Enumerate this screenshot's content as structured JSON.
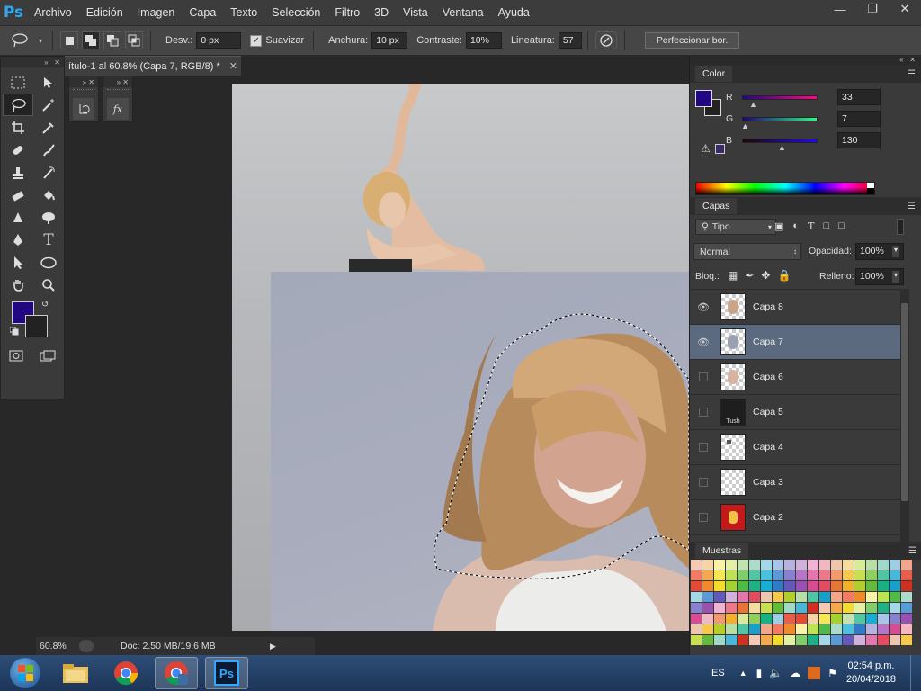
{
  "app": {
    "logo": "Ps"
  },
  "menu": [
    "Archivo",
    "Edición",
    "Imagen",
    "Capa",
    "Texto",
    "Selección",
    "Filtro",
    "3D",
    "Vista",
    "Ventana",
    "Ayuda"
  ],
  "options": {
    "feather_label": "Desv.:",
    "feather_value": "0 px",
    "antialias_label": "Suavizar",
    "antialias_checked": true,
    "width_label": "Anchura:",
    "width_value": "10 px",
    "contrast_label": "Contraste:",
    "contrast_value": "10%",
    "frequency_label": "Lineatura:",
    "frequency_value": "57",
    "refine_button": "Perfeccionar bor."
  },
  "document": {
    "tab_title": "ítulo-1 al 60.8% (Capa 7, RGB/8) *",
    "zoom": "60.8%",
    "doc_info": "Doc: 2.50 MB/19.6 MB"
  },
  "color_panel": {
    "title": "Color",
    "foreground": "#210782",
    "background": "#222222",
    "channels": [
      {
        "label": "R",
        "value": "33"
      },
      {
        "label": "G",
        "value": "7"
      },
      {
        "label": "B",
        "value": "130"
      }
    ]
  },
  "layers_panel": {
    "title": "Capas",
    "filter_label": "Tipo",
    "blend_mode": "Normal",
    "opacity_label": "Opacidad:",
    "opacity_value": "100%",
    "lock_label": "Bloq.:",
    "fill_label": "Relleno:",
    "fill_value": "100%",
    "layers": [
      {
        "name": "Capa 8",
        "visible": true,
        "selected": false
      },
      {
        "name": "Capa 7",
        "visible": true,
        "selected": true
      },
      {
        "name": "Capa 6",
        "visible": false,
        "selected": false
      },
      {
        "name": "Capa 5",
        "visible": false,
        "selected": false
      },
      {
        "name": "Capa 4",
        "visible": false,
        "selected": false
      },
      {
        "name": "Capa 3",
        "visible": false,
        "selected": false
      },
      {
        "name": "Capa 2",
        "visible": false,
        "selected": false
      }
    ]
  },
  "swatches_panel": {
    "title": "Muestras"
  },
  "taskbar": {
    "language": "ES",
    "time": "02:54 p.m.",
    "date": "20/04/2018"
  }
}
